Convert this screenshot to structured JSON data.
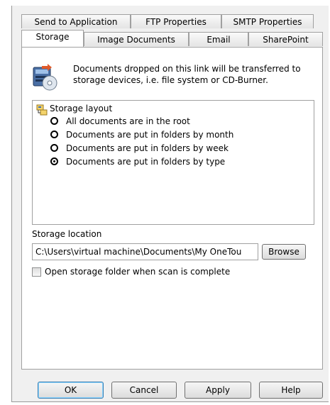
{
  "tabs_row1": [
    "Send to Application",
    "FTP Properties",
    "SMTP Properties"
  ],
  "tabs_row2": [
    "Storage",
    "Image Documents",
    "Email",
    "SharePoint"
  ],
  "active_tab": "Storage",
  "storage": {
    "description": "Documents dropped on this link will be transferred to storage devices, i.e. file system or CD-Burner.",
    "layout_title": "Storage layout",
    "layout_options": [
      {
        "label": "All documents are in the root",
        "checked": false
      },
      {
        "label": "Documents are put in folders by month",
        "checked": false
      },
      {
        "label": "Documents are put in folders by week",
        "checked": false
      },
      {
        "label": "Documents are put in folders by type",
        "checked": true
      }
    ],
    "location_label": "Storage location",
    "location_value": "C:\\Users\\virtual machine\\Documents\\My OneTou",
    "browse_label": "Browse",
    "open_folder_label": "Open storage folder when scan is complete",
    "open_folder_checked": false
  },
  "buttons": {
    "ok": "OK",
    "cancel": "Cancel",
    "apply": "Apply",
    "help": "Help"
  },
  "icons": {
    "info": "storage-device-icon",
    "layout": "folder-tree-icon"
  }
}
